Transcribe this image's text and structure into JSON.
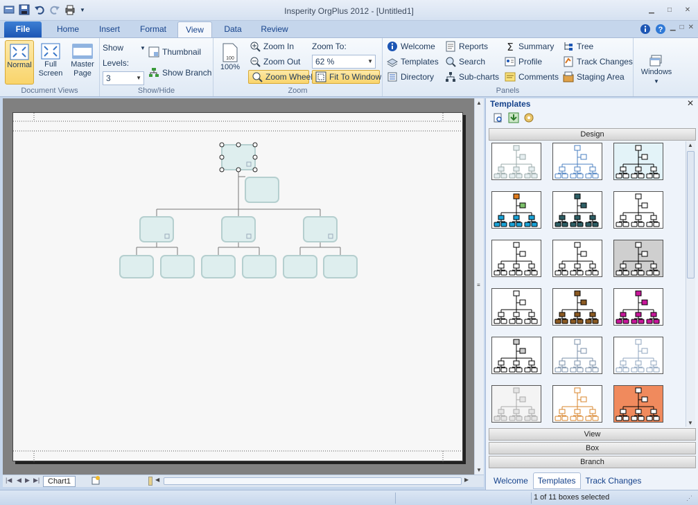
{
  "window": {
    "title": "Insperity OrgPlus 2012 - [Untitled1]"
  },
  "tabs": [
    "File",
    "Home",
    "Insert",
    "Format",
    "View",
    "Data",
    "Review"
  ],
  "active_tab": "View",
  "ribbon": {
    "document_views": {
      "label": "Document Views",
      "normal": "Normal",
      "full_screen_1": "Full",
      "full_screen_2": "Screen",
      "master_page_1": "Master",
      "master_page_2": "Page"
    },
    "show_hide": {
      "label": "Show/Hide",
      "show": "Show",
      "levels": "Levels:",
      "levels_value": "3",
      "thumbnail": "Thumbnail",
      "show_branch": "Show Branch"
    },
    "zoom": {
      "label": "Zoom",
      "zoom_100": "100%",
      "zoom_in": "Zoom In",
      "zoom_out": "Zoom Out",
      "zoom_wheel": "Zoom Wheel",
      "zoom_to": "Zoom To:",
      "zoom_value": "62 %",
      "fit_to_window": "Fit To Window"
    },
    "panels": {
      "label": "Panels",
      "welcome": "Welcome",
      "templates": "Templates",
      "directory": "Directory",
      "reports": "Reports",
      "search": "Search",
      "sub_charts": "Sub-charts",
      "summary": "Summary",
      "profile": "Profile",
      "comments": "Comments",
      "tree": "Tree",
      "track_changes": "Track Changes",
      "staging_area": "Staging Area"
    },
    "windows": {
      "label": "Windows"
    }
  },
  "sheet_tabs": [
    "Chart1"
  ],
  "panel": {
    "title": "Templates",
    "design_bar": "Design",
    "view_bar": "View",
    "box_bar": "Box",
    "branch_bar": "Branch",
    "bottom_tabs": [
      "Welcome",
      "Templates",
      "Track Changes"
    ],
    "active_bottom_tab": "Templates",
    "templates": [
      {
        "style": "pale",
        "top": "#e6eef0",
        "mid": "#e6eef0",
        "bot": "#e6eef0",
        "line": "#9aa",
        "bg": "#fff"
      },
      {
        "style": "blue-outline",
        "top": "#fff",
        "mid": "#fff",
        "bot": "#fff",
        "line": "#4a7fc0",
        "bg": "#fff"
      },
      {
        "style": "black-on-blue",
        "top": "#fff",
        "mid": "#fff",
        "bot": "#fff",
        "line": "#000",
        "bg": "#e3f3f8"
      },
      {
        "style": "orange-cyan",
        "top": "#e07b1d",
        "mid": "#7cc06a",
        "bot": "#1aa3d8",
        "line": "#000",
        "bg": "#fff"
      },
      {
        "style": "teal",
        "top": "#2e5f66",
        "mid": "#2e5f66",
        "bot": "#2e5f66",
        "line": "#000",
        "bg": "#fff"
      },
      {
        "style": "black-outline",
        "top": "#fff",
        "mid": "#fff",
        "bot": "#fff",
        "line": "#000",
        "bg": "#fff"
      },
      {
        "style": "black-outline-2",
        "top": "#fff",
        "mid": "#fff",
        "bot": "#fff",
        "line": "#000",
        "bg": "#fff"
      },
      {
        "style": "black-outline-3",
        "top": "#fff",
        "mid": "#fff",
        "bot": "#fff",
        "line": "#000",
        "bg": "#fff"
      },
      {
        "style": "gray-bg",
        "top": "#fff",
        "mid": "#fff",
        "bot": "#fff",
        "line": "#000",
        "bg": "#cfcfcf"
      },
      {
        "style": "black-outline-4",
        "top": "#fff",
        "mid": "#fff",
        "bot": "#fff",
        "line": "#000",
        "bg": "#fff"
      },
      {
        "style": "brown",
        "top": "#8b5a22",
        "mid": "#8b5a22",
        "bot": "#8b5a22",
        "line": "#000",
        "bg": "#fff"
      },
      {
        "style": "magenta",
        "top": "#c8179a",
        "mid": "#c8179a",
        "bot": "#c8179a",
        "line": "#000",
        "bg": "#fff"
      },
      {
        "style": "gray-box",
        "top": "#ccc",
        "mid": "#ccc",
        "bot": "#fff",
        "line": "#000",
        "bg": "#fff"
      },
      {
        "style": "steel-outline",
        "top": "#fff",
        "mid": "#fff",
        "bot": "#fff",
        "line": "#7a8fa8",
        "bg": "#fff"
      },
      {
        "style": "light-steel",
        "top": "#fff",
        "mid": "#fff",
        "bot": "#fff",
        "line": "#8fa5bf",
        "bg": "#fff"
      },
      {
        "style": "pale-gray",
        "top": "#e5e5e5",
        "mid": "#e5e5e5",
        "bot": "#e5e5e5",
        "line": "#aaa",
        "bg": "#f4f4f4"
      },
      {
        "style": "orange-outline",
        "top": "#fff",
        "mid": "#fff",
        "bot": "#fff",
        "line": "#d9842b",
        "bg": "#fff"
      },
      {
        "style": "orange-bg",
        "top": "#fff",
        "mid": "#fff",
        "bot": "#fff",
        "line": "#000",
        "bg": "#f08a5d"
      }
    ]
  },
  "status": {
    "selection": "1 of 11 boxes selected"
  },
  "colors": {
    "box_fill": "#deeeee",
    "box_stroke": "#b5cfcf",
    "accent": "#1c56b4"
  }
}
